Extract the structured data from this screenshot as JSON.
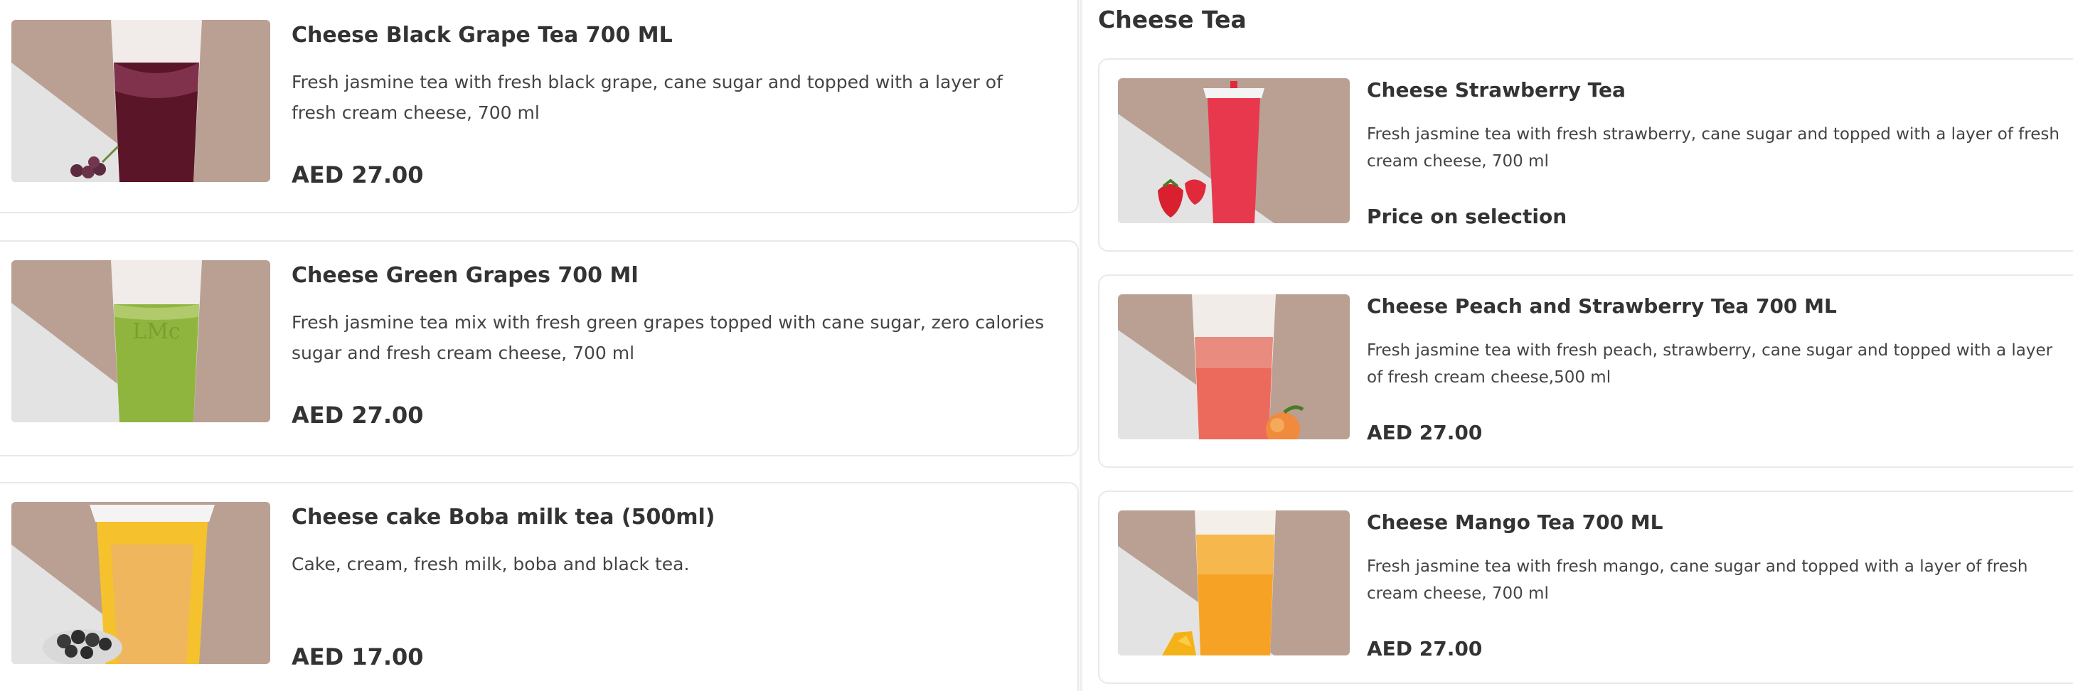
{
  "left_items": [
    {
      "name": "Cheese Black Grape Tea 700 ML",
      "description": "Fresh jasmine tea with fresh black grape, cane sugar and topped with a layer of fresh cream cheese, 700 ml",
      "price": "AED 27.00",
      "drink_color": "#5a1628",
      "garnish": "black-grapes-icon"
    },
    {
      "name": "Cheese Green Grapes 700 Ml",
      "description": "Fresh jasmine tea mix with fresh green grapes topped with cane sugar, zero calories sugar and fresh cream cheese, 700 ml",
      "price": "AED 27.00",
      "drink_color": "#8fb53e",
      "garnish": "none"
    },
    {
      "name": "Cheese cake Boba milk tea (500ml)",
      "description": "Cake, cream, fresh milk, boba and black tea.",
      "price": "AED 17.00",
      "drink_color": "#f5c22e",
      "garnish": "boba-pearls-icon"
    }
  ],
  "right_section": {
    "title": "Cheese Tea",
    "items": [
      {
        "name": "Cheese Strawberry Tea",
        "description": "Fresh jasmine tea with fresh strawberry, cane sugar and topped with a layer of fresh cream cheese, 700 ml",
        "price": "Price on selection",
        "drink_color": "#e8384d",
        "garnish": "strawberry-icon"
      },
      {
        "name": "Cheese Peach and Strawberry Tea 700 ML",
        "description": "Fresh jasmine tea with fresh peach, strawberry, cane sugar and topped with a layer of fresh cream cheese,500 ml",
        "price": "AED 27.00",
        "drink_color": "#ec6a5c",
        "garnish": "peach-icon"
      },
      {
        "name": "Cheese Mango Tea 700 ML",
        "description": "Fresh jasmine tea with fresh mango, cane sugar and topped with a layer of fresh cream cheese, 700 ml",
        "price": "AED 27.00",
        "drink_color": "#f6a325",
        "garnish": "mango-icon"
      }
    ]
  },
  "colors": {
    "image_bg_brown": "#b9a093",
    "image_bg_grey": "#e3e3e3",
    "card_border": "#e9e9e9",
    "text": "#333333"
  }
}
